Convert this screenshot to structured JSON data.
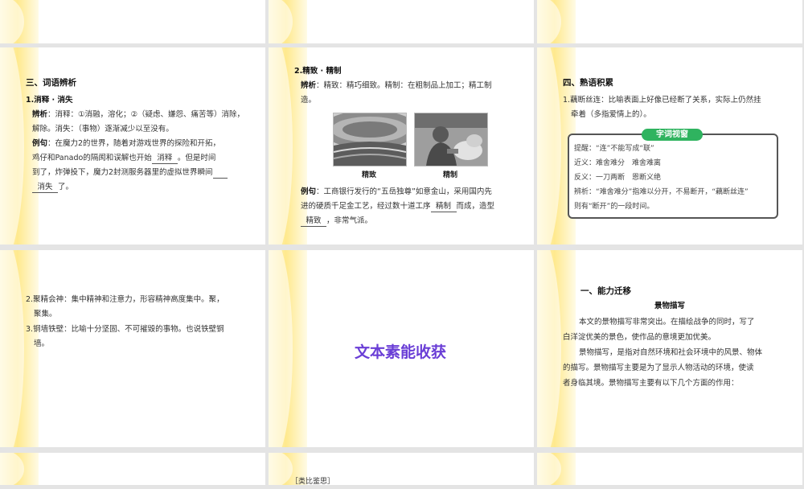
{
  "slide4": {
    "heading": "三、词语辨析",
    "term": "1.消释 · 消失",
    "def_label": "辨析",
    "def_l1": "：消释：①消融，溶化；②（疑虑、嫌怨、痛苦等）消除，",
    "def_l2": "解除。消失：（事物）逐渐减少以至没有。",
    "ex_label": "例句",
    "ex_l1": "：在魔力2的世界，随着对游戏世界的探险和开拓，",
    "ex_l2a": "鸡仔和Panado的隔阂和误解也开始",
    "ex_blank1": "消释",
    "ex_l2b": "。但是时间",
    "ex_l3": "到了，炸弹投下，魔力2封测服务器里的虚拟世界瞬间",
    "ex_blank2": "消失",
    "ex_l4": "了。"
  },
  "slide5": {
    "term": "2.精致 · 精制",
    "def_label": "辨析",
    "def_l1": "：精致：精巧细致。精制：在粗制品上加工；精工制",
    "def_l2": "造。",
    "cap1": "精致",
    "cap2": "精制",
    "ex_label": "例句",
    "ex_l1": "：工商银行发行的“五岳独尊”如意金山，采用国内先",
    "ex_l2a": "进的硬质千足金工艺，经过数十道工序",
    "ex_blank1": "精制",
    "ex_l2b": "而成，造型",
    "ex_blank2": "精致",
    "ex_l3": "，非常气派。"
  },
  "slide6": {
    "heading": "四、熟语积累",
    "item1_l1": "1.藕断丝连：比喻表面上好像已经断了关系，实际上仍然挂",
    "item1_l2": "牵着（多指爱情上的）。",
    "window_title": "字词视窗",
    "w1": "提醒：“连”不能写成“联”",
    "w2": "近义：难舍难分　难舍难离",
    "w3": "反义：一刀两断　恩断义绝",
    "w4": "辨析：“难舍难分”指难以分开，不易断开，“藕断丝连”",
    "w5": "则有“断开”的一段时间。"
  },
  "slide7": {
    "item2_l1": "2.聚精会神：集中精神和注意力，形容精神高度集中。聚，",
    "item2_l2": "聚集。",
    "item3_l1": "3.铜墙铁壁：比喻十分坚固、不可摧毁的事物。也说铁壁铜",
    "item3_l2": "墙。"
  },
  "slide8": {
    "title": "文本素能收获"
  },
  "slide9": {
    "heading": "一、能力迁移",
    "subheading": "景物描写",
    "p1_l1": "本文的景物描写非常突出。在描绘战争的同时，写了",
    "p1_l2": "白洋淀优美的景色，使作品的意境更加优美。",
    "p2_l1": "景物描写，是指对自然环境和社会环境中的风景、物体",
    "p2_l2": "的描写。景物描写主要是为了显示人物活动的环境，使读",
    "p2_l3": "者身临其境。景物描写主要有以下几个方面的作用："
  },
  "slide11": {
    "partial_label": "［类比鉴思］"
  }
}
